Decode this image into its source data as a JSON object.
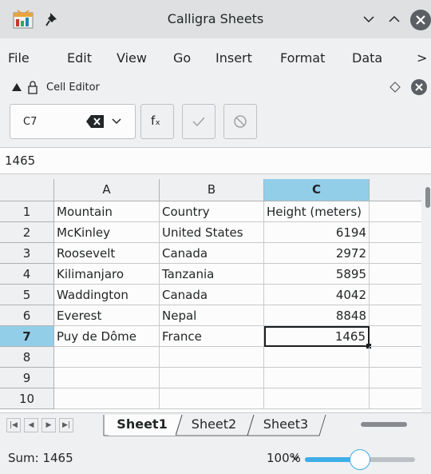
{
  "window": {
    "title": "Calligra Sheets"
  },
  "icons": {
    "app": "calligra-sheets-app-icon",
    "pin": "pin-icon",
    "minimize": "chevron-down-icon",
    "maximize": "chevron-up-icon",
    "close": "close-icon"
  },
  "menu": {
    "items": [
      "File",
      "Edit",
      "View",
      "Go",
      "Insert",
      "Format",
      "Data"
    ],
    "more": ">"
  },
  "cell_editor": {
    "title": "Cell Editor",
    "cell_ref": "C7",
    "function_label": "fₓ",
    "formula_value": "1465"
  },
  "grid": {
    "columns": [
      "A",
      "B",
      "C"
    ],
    "selected_column": "C",
    "selected_row": "7",
    "row_numbers": [
      "1",
      "2",
      "3",
      "4",
      "5",
      "6",
      "7",
      "8",
      "9",
      "10"
    ],
    "rows": [
      [
        "Mountain",
        "Country",
        "Height (meters)"
      ],
      [
        "McKinley",
        "United States",
        "6194"
      ],
      [
        "Roosevelt",
        "Canada",
        "2972"
      ],
      [
        "Kilimanjaro",
        "Tanzania",
        "5895"
      ],
      [
        "Waddington",
        "Canada",
        "4042"
      ],
      [
        "Everest",
        "Nepal",
        "8848"
      ],
      [
        "Puy de Dôme",
        "France",
        "1465"
      ],
      [
        "",
        "",
        ""
      ],
      [
        "",
        "",
        ""
      ],
      [
        "",
        "",
        ""
      ]
    ]
  },
  "sheets": {
    "tabs": [
      "Sheet1",
      "Sheet2",
      "Sheet3"
    ],
    "active": "Sheet1"
  },
  "status": {
    "sum": "Sum: 1465",
    "zoom": "100%",
    "zoom_level": 0.5
  },
  "colors": {
    "accent": "#3daee9",
    "selection_header": "#93cee9",
    "window_bg": "#eff0f1",
    "cell_bg": "#fcfcfc"
  }
}
